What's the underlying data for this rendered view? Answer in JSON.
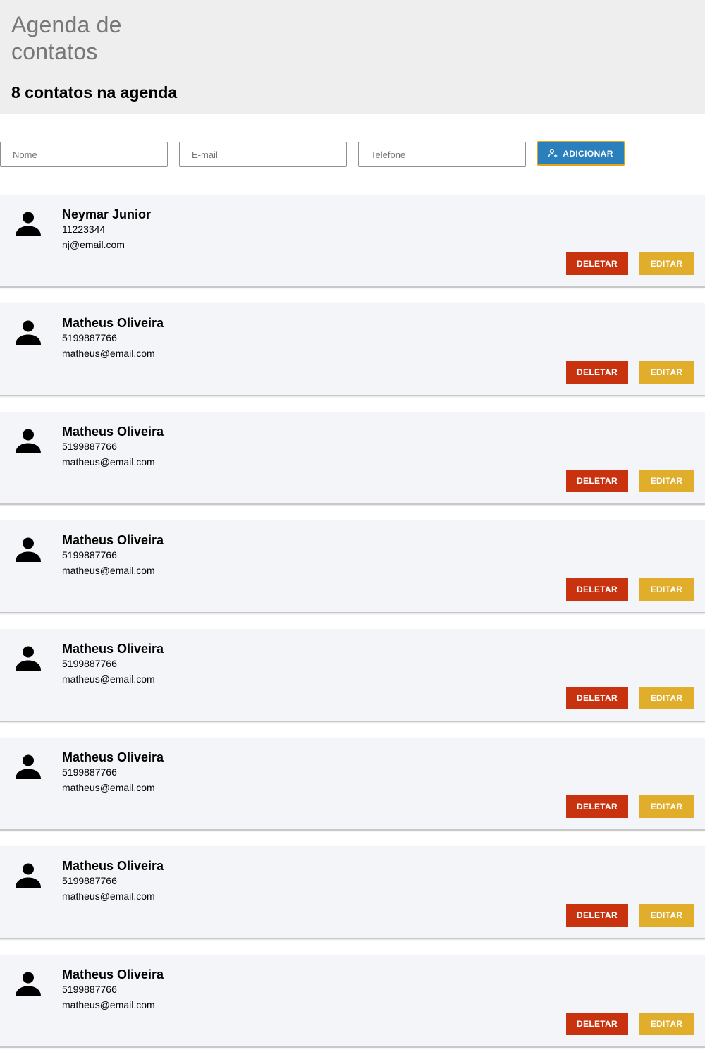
{
  "header": {
    "title": "Agenda de\ncontatos",
    "count_label": "8 contatos na agenda"
  },
  "form": {
    "name_placeholder": "Nome",
    "email_placeholder": "E-mail",
    "phone_placeholder": "Telefone",
    "add_label": "ADICIONAR",
    "add_icon": "person-add-icon",
    "add_color": "#2a7fbd"
  },
  "contacts": [
    {
      "name": "Neymar Junior",
      "phone": "11223344",
      "email": "nj@email.com"
    },
    {
      "name": "Matheus Oliveira",
      "phone": "5199887766",
      "email": "matheus@email.com"
    },
    {
      "name": "Matheus Oliveira",
      "phone": "5199887766",
      "email": "matheus@email.com"
    },
    {
      "name": "Matheus Oliveira",
      "phone": "5199887766",
      "email": "matheus@email.com"
    },
    {
      "name": "Matheus Oliveira",
      "phone": "5199887766",
      "email": "matheus@email.com"
    },
    {
      "name": "Matheus Oliveira",
      "phone": "5199887766",
      "email": "matheus@email.com"
    },
    {
      "name": "Matheus Oliveira",
      "phone": "5199887766",
      "email": "matheus@email.com"
    },
    {
      "name": "Matheus Oliveira",
      "phone": "5199887766",
      "email": "matheus@email.com"
    }
  ],
  "actions": {
    "delete_label": "DELETAR",
    "edit_label": "EDITAR",
    "delete_color": "#c8320f",
    "edit_color": "#e1ae2c"
  }
}
